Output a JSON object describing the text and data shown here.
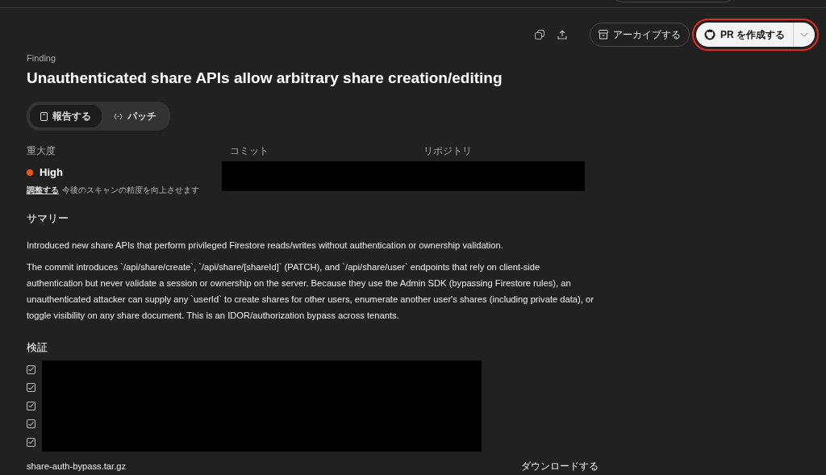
{
  "toolbar": {
    "archive_button": "アーカイブする",
    "pr_button": {
      "label": "PR を作成する",
      "highlighted": true
    }
  },
  "eyebrow": "Finding",
  "title": "Unauthenticated share APIs allow arbitrary share creation/editing",
  "tabs": [
    {
      "label": "報告する",
      "selected": true
    },
    {
      "label": "パッチ",
      "selected": false
    }
  ],
  "details": {
    "severity_label": "重大度",
    "severity": {
      "label": "High",
      "color": "#e8541c"
    },
    "adjust_link": "調整する",
    "adjust_hint": "今後のスキャンの精度を向上させます",
    "commit_label": "コミット",
    "repository_label": "リポジトリ",
    "redacted": true
  },
  "summary": {
    "heading": "サマリー",
    "paragraphs": [
      "Introduced new share APIs that perform privileged Firestore reads/writes without authentication or ownership validation.",
      "The commit introduces `/api/share/create`, `/api/share/[shareId]` (PATCH), and `/api/share/user` endpoints that rely on client-side authentication but never validate a session or ownership on the server. Because they use the Admin SDK (bypassing Firestore rules), an unauthenticated attacker can supply any `userId` to create shares for other users, enumerate another user's shares (including private data), or toggle visibility on any share document. This is an IDOR/authorization bypass across tenants."
    ]
  },
  "verification": {
    "heading": "検証",
    "checks": [
      {
        "checked": true
      },
      {
        "checked": true
      },
      {
        "checked": true
      },
      {
        "checked": true
      },
      {
        "checked": true
      }
    ],
    "redacted": true
  },
  "attachment": {
    "filename": "share-auth-bypass.tar.gz",
    "action": "ダウンロードする"
  }
}
